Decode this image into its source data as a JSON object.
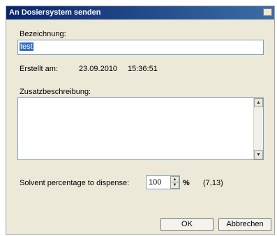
{
  "window": {
    "title": "An Dosiersystem senden",
    "close_symbol": "✕"
  },
  "form": {
    "name_label": "Bezeichnung:",
    "name_value": "test",
    "created_label": "Erstellt am:",
    "created_date": "23.09.2010",
    "created_time": "15:36:51",
    "description_label": "Zusatzbeschreibung:",
    "description_value": "",
    "solvent_label": "Solvent percentage to dispense:",
    "solvent_value": "100",
    "solvent_unit": "%",
    "solvent_extra": "(7,13)"
  },
  "icons": {
    "scroll_up": "▲",
    "scroll_down": "▼",
    "spin_up": "▲",
    "spin_down": "▼"
  },
  "buttons": {
    "ok": "OK",
    "cancel": "Abbrechen"
  }
}
